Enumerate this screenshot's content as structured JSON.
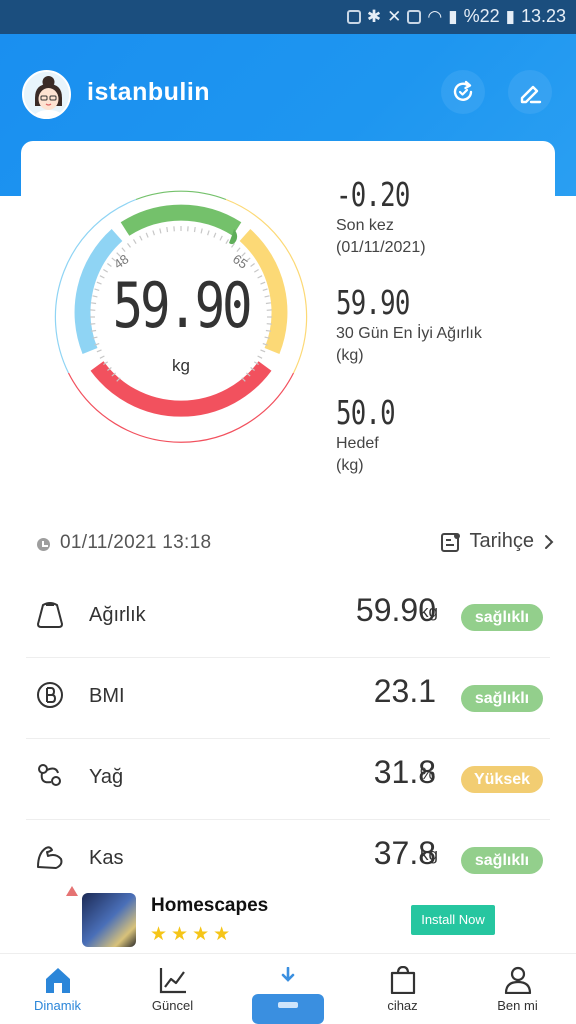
{
  "status_bar": {
    "battery": "%22",
    "time": "13.23"
  },
  "header": {
    "username": "istanbulin",
    "refresh_icon": "refresh-icon",
    "edit_icon": "edit-icon"
  },
  "gauge": {
    "value": "59.90",
    "unit": "kg",
    "range_low": "48",
    "range_high": "65",
    "colors": {
      "blue": "#8fd4f4",
      "green": "#74c16b",
      "yellow": "#fcd976",
      "red": "#f2515e"
    }
  },
  "stats": {
    "last_change": "-0.20",
    "last_label": "Son kez",
    "last_date": "(01/11/2021)",
    "best_value": "59.90",
    "best_label": "30 Gün En İyi Ağırlık",
    "best_unit": "(kg)",
    "goal_value": "50.0",
    "goal_label": "Hedef",
    "goal_unit": "(kg)"
  },
  "measurement": {
    "datetime": "01/11/2021 13:18",
    "history_label": "Tarihçe"
  },
  "metrics": [
    {
      "icon": "weight-bag-icon",
      "label": "Ağırlık",
      "value": "59.90",
      "unit": "kg",
      "badge": "sağlıklı",
      "badge_color": "#93cf8c"
    },
    {
      "icon": "bmi-icon",
      "label": "BMI",
      "value": "23.1",
      "unit": "",
      "badge": "sağlıklı",
      "badge_color": "#93cf8c"
    },
    {
      "icon": "fat-icon",
      "label": "Yağ",
      "value": "31.8",
      "unit": "%",
      "badge": "Yüksek",
      "badge_color": "#f2cd72"
    },
    {
      "icon": "muscle-icon",
      "label": "Kas",
      "value": "37.8",
      "unit": "kg",
      "badge": "sağlıklı",
      "badge_color": "#93cf8c"
    }
  ],
  "ad": {
    "title": "Homescapes",
    "stars": "★★★★",
    "rating": 4,
    "button": "Install Now"
  },
  "nav": {
    "items": [
      {
        "icon": "home-icon",
        "label": "Dinamik",
        "active": true
      },
      {
        "icon": "chart-icon",
        "label": "Güncel",
        "active": false
      },
      {
        "icon": "scale-icon",
        "label": "",
        "active": false
      },
      {
        "icon": "bag-icon",
        "label": "cihaz",
        "active": false
      },
      {
        "icon": "user-icon",
        "label": "Ben mi",
        "active": false
      }
    ],
    "active_color": "#2b86d9"
  }
}
